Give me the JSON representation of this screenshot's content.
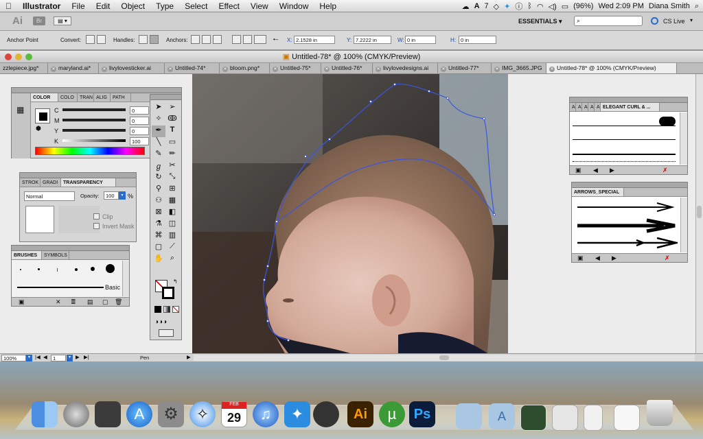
{
  "menubar": {
    "app": "Illustrator",
    "items": [
      "File",
      "Edit",
      "Object",
      "Type",
      "Select",
      "Effect",
      "View",
      "Window",
      "Help"
    ],
    "battery": "(96%)",
    "clock": "Wed 2:09 PM",
    "user": "Diana Smith",
    "notif": "7"
  },
  "appbar": {
    "logo": "Ai",
    "br": "Br",
    "workspace": "ESSENTIALS ▾",
    "cslive": "CS Live"
  },
  "ctrlbar": {
    "tool": "Anchor Point",
    "convert": "Convert:",
    "handles": "Handles:",
    "anchors": "Anchors:",
    "x_label": "X:",
    "x": "2.1528 in",
    "y_label": "Y:",
    "y": "7.2222 in",
    "w_label": "W:",
    "w": "0 in",
    "h_label": "H:",
    "h": "0 in"
  },
  "window": {
    "title": "Untitled-78* @ 100% (CMYK/Preview)"
  },
  "tabs": [
    "zzlepiece.jpg*",
    "maryland.ai*",
    "livylovesticker.ai",
    "Untitled-74*",
    "bloom.png*",
    "Untitled-75*",
    "Untitled-76*",
    "livylovedesigns.ai",
    "Untitled-77*",
    "IMG_3665.JPG",
    "Untitled-78* @ 100% (CMYK/Preview)"
  ],
  "color_panel": {
    "tabs": [
      "COLOR",
      "COLO",
      "TRAN",
      "ALIG",
      "PATH"
    ],
    "rows": [
      {
        "label": "C",
        "value": "0"
      },
      {
        "label": "M",
        "value": "0"
      },
      {
        "label": "Y",
        "value": "0"
      },
      {
        "label": "K",
        "value": "100"
      }
    ],
    "unit": "%"
  },
  "transparency_panel": {
    "tabs": [
      "STROK",
      "GRADI",
      "TRANSPARENCY"
    ],
    "mode": "Normal",
    "opacity_label": "Opacity:",
    "opacity": "100",
    "unit": "%",
    "clip": "Clip",
    "invert": "Invert Mask"
  },
  "brushes_panel": {
    "tabs": [
      "BRUSHES",
      "SYMBOLS"
    ],
    "basic": "Basic"
  },
  "elegant_panel": {
    "title": "ELEGANT CURL & ..."
  },
  "arrows_panel": {
    "title": "ARROWS_SPECIAL"
  },
  "status": {
    "zoom": "100%",
    "page": "1",
    "tool": "Pen"
  },
  "dock": {
    "calendar_day": "29",
    "calendar_month": "FEB"
  },
  "colors": {
    "path": "#3a56e0",
    "panel": "#d6d6d6",
    "accent": "#2a6ccc"
  }
}
